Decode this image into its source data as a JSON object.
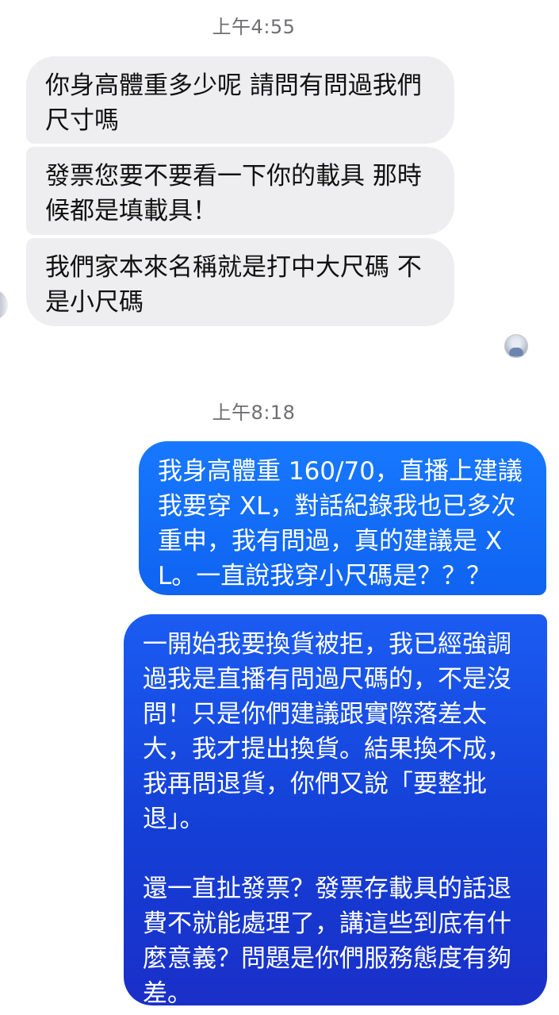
{
  "chat": {
    "timestamps": [
      "上午4:55",
      "上午8:18"
    ],
    "incoming_messages": [
      "你身高體重多少呢 請問有問過我們尺寸嗎",
      "發票您要不要看一下你的載具 那時候都是填載具！",
      "我們家本來名稱就是打中大尺碼 不是小尺碼"
    ],
    "outgoing_messages": [
      "我身高體重 160/70，直播上建議我要穿 XL，對話紀錄我也已多次重申，我有問過，真的建議是 XL。一直說我穿小尺碼是？？？",
      "一開始我要換貨被拒，我已經強調過我是直播有問過尺碼的，不是沒問！只是你們建議跟實際落差太大，我才提出換貨。結果換不成，我再問退貨，你們又說「要整批退」。\n\n還一直扯發票？發票存載具的話退費不就能處理了，講這些到底有什麼意義？問題是你們服務態度有夠差。"
    ],
    "colors": {
      "incoming_bubble": "#eeeef0",
      "outgoing_bubble_start": "#1778ff",
      "outgoing_bubble_end": "#1a2fc8",
      "timestamp_text": "#6f6f73"
    }
  }
}
